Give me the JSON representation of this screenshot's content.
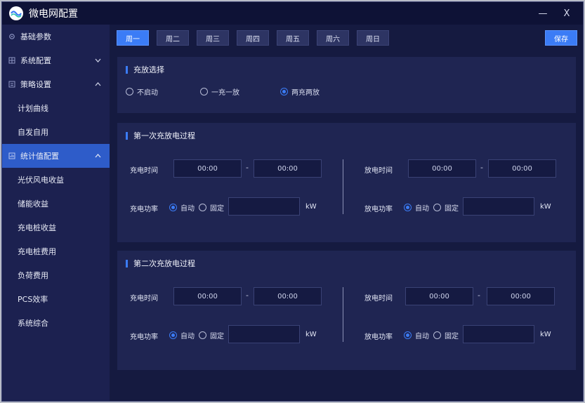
{
  "window": {
    "title": "微电网配置",
    "minimize": "—",
    "close": "X"
  },
  "sidebar": {
    "items": [
      {
        "label": "基础参数",
        "icon": "gear-icon"
      },
      {
        "label": "系统配置",
        "icon": "grid-icon",
        "chevron": "chevron-down-icon"
      },
      {
        "label": "策略设置",
        "icon": "list-icon",
        "chevron": "chevron-up-icon"
      },
      {
        "label": "计划曲线"
      },
      {
        "label": "自发自用"
      },
      {
        "label": "统计值配置",
        "icon": "stats-icon",
        "chevron": "chevron-up-icon"
      },
      {
        "label": "光伏风电收益"
      },
      {
        "label": "储能收益"
      },
      {
        "label": "充电桩收益"
      },
      {
        "label": "充电桩费用"
      },
      {
        "label": "负荷费用"
      },
      {
        "label": "PCS效率"
      },
      {
        "label": "系统综合"
      }
    ],
    "active_index": 5
  },
  "tabs": {
    "days": [
      "周一",
      "周二",
      "周三",
      "周四",
      "周五",
      "周六",
      "周日"
    ],
    "active_index": 0,
    "save_label": "保存"
  },
  "charge_select": {
    "title": "充放选择",
    "options": [
      "不启动",
      "一充一放",
      "两充两放"
    ],
    "selected_index": 2
  },
  "process1": {
    "title": "第一次充放电过程",
    "charge_time_label": "充电时间",
    "charge_start": "00:00",
    "charge_end": "00:00",
    "discharge_time_label": "放电时间",
    "discharge_start": "00:00",
    "discharge_end": "00:00",
    "charge_power_label": "充电功率",
    "discharge_power_label": "放电功率",
    "auto_label": "自动",
    "fixed_label": "固定",
    "unit": "kW",
    "dash": "-"
  },
  "process2": {
    "title": "第二次充放电过程",
    "charge_time_label": "充电时间",
    "charge_start": "00:00",
    "charge_end": "00:00",
    "discharge_time_label": "放电时间",
    "discharge_start": "00:00",
    "discharge_end": "00:00",
    "charge_power_label": "充电功率",
    "discharge_power_label": "放电功率",
    "auto_label": "自动",
    "fixed_label": "固定",
    "unit": "kW",
    "dash": "-"
  },
  "colors": {
    "accent": "#3b7cf6",
    "background": "#151a40",
    "sidebar": "#1c2150",
    "panel": "#1f2552"
  }
}
